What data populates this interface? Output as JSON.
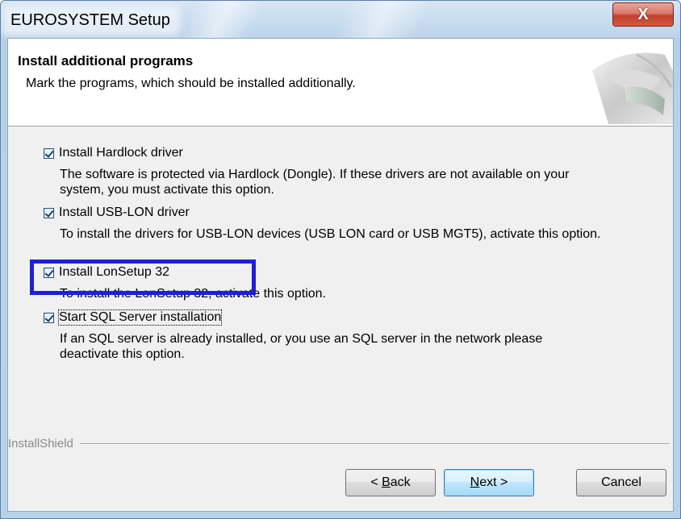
{
  "window": {
    "title": "EUROSYSTEM Setup",
    "close_label": "X"
  },
  "header": {
    "title": "Install additional programs",
    "subtitle": "Mark the programs, which should be installed additionally."
  },
  "options": [
    {
      "label": "Install Hardlock driver",
      "checked": true,
      "desc_lines": [
        "The software is protected via Hardlock (Dongle). If these drivers are not available on your",
        "system, you must activate this option."
      ]
    },
    {
      "label": "Install USB-LON driver",
      "checked": true,
      "desc_lines": [
        "To install the drivers for USB-LON devices (USB LON card or USB MGT5), activate this option."
      ]
    },
    {
      "label": "Install LonSetup 32",
      "checked": true,
      "desc_lines": [
        "To install the LonSetup 32, activate this option."
      ]
    },
    {
      "label": "Start SQL Server installation",
      "checked": true,
      "desc_lines": [
        "If an SQL server is already installed, or you use an SQL server in the network please",
        "deactivate this option."
      ]
    }
  ],
  "footer": {
    "brand": "InstallShield"
  },
  "buttons": {
    "back_prefix": "< ",
    "back_mnemonic": "B",
    "back_rest": "ack",
    "next_mnemonic": "N",
    "next_rest": "ext >",
    "cancel": "Cancel"
  },
  "colors": {
    "highlight": "#1f1fd6",
    "close_button": "#c2402d"
  }
}
